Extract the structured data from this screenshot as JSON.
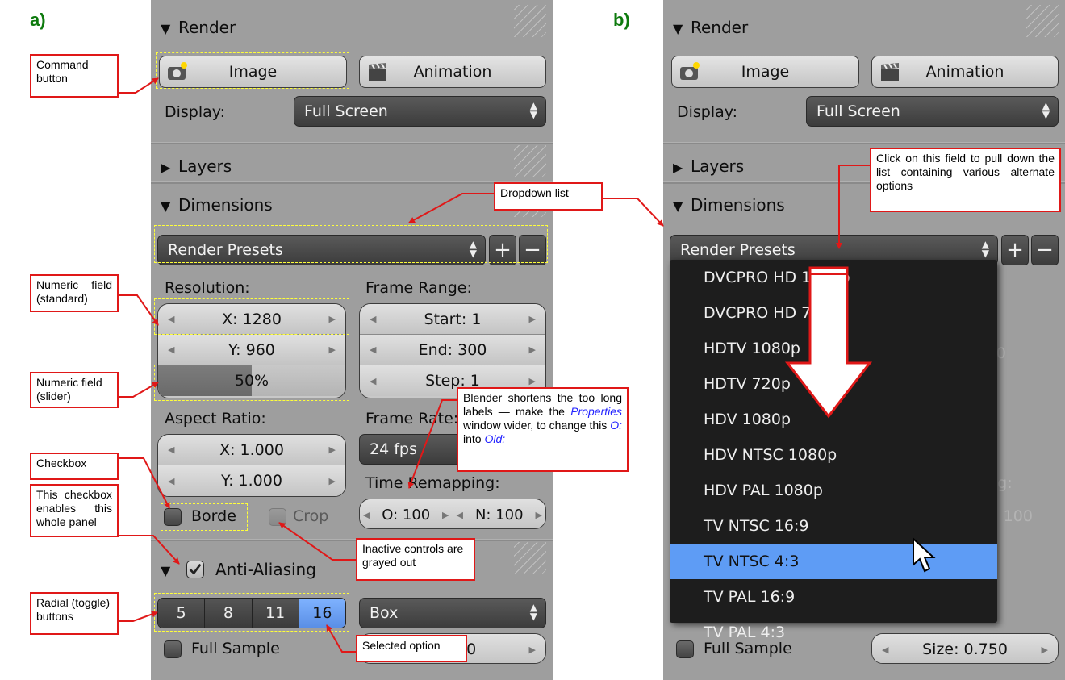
{
  "panel_a_letter": "a)",
  "panel_b_letter": "b)",
  "render": {
    "header": "Render",
    "image_label": "Image",
    "animation_label": "Animation",
    "display_label": "Display:",
    "display_value": "Full Screen"
  },
  "layers_header": "Layers",
  "dimensions": {
    "header": "Dimensions",
    "presets": "Render Presets",
    "resolution_label": "Resolution:",
    "res_x": "X: 1280",
    "res_y": "Y: 960",
    "res_pct": "50%",
    "res_pct_value": 0.5,
    "frame_range_label": "Frame Range:",
    "start": "Start: 1",
    "end": "End: 300",
    "step": "Step: 1",
    "aspect_label": "Aspect Ratio:",
    "asp_x": "X: 1.000",
    "asp_y": "Y: 1.000",
    "frame_rate_label": "Frame Rate:",
    "frame_rate": "24 fps",
    "border_label": "Borde",
    "crop_label": "Crop",
    "time_remap_label": "Time Remapping:",
    "old": "O: 100",
    "new": "N: 100"
  },
  "antialiasing": {
    "header": "Anti-Aliasing",
    "samples": [
      "5",
      "8",
      "11",
      "16"
    ],
    "selected_index": 3,
    "filter": "Box",
    "full_sample": "Full Sample",
    "size": "Size: 0.750",
    "size_partial": "50"
  },
  "dropdown_menu": {
    "items": [
      "DVCPRO HD 1080p",
      "DVCPRO HD 720p",
      "HDTV 1080p",
      "HDTV 720p",
      "HDV 1080p",
      "HDV NTSC 1080p",
      "HDV PAL 1080p",
      "TV NTSC 16:9",
      "TV NTSC 4:3",
      "TV PAL 16:9",
      "TV PAL 4:3"
    ],
    "selected_index": 8
  },
  "callouts": {
    "command_button": "Command button",
    "numeric_standard": "Numeric field (standard)",
    "numeric_slider": "Numeric field (slider)",
    "checkbox": "Checkbox",
    "panel_checkbox": "This checkbox enables this whole panel",
    "radial": "Radial (toggle) buttons",
    "dropdown_list": "Dropdown list",
    "blender_shortens_1": "Blender shortens the too long labels — make the ",
    "blender_properties": "Properties",
    "blender_shortens_2": " window wider, to change this ",
    "blender_o": "O:",
    "blender_shortens_3": " into ",
    "blender_old": "Old:",
    "inactive": "Inactive controls are grayed out",
    "selected_option": "Selected option",
    "click_field": "Click on this field to pull down the list containing various alternate options"
  },
  "colors": {
    "panel_bg": "#9e9e9e",
    "selected_blue": "#5e9cf5",
    "callout_border": "#e01818",
    "highlight_dash": "#ffff3a",
    "letter_green": "#0d7a0d"
  }
}
